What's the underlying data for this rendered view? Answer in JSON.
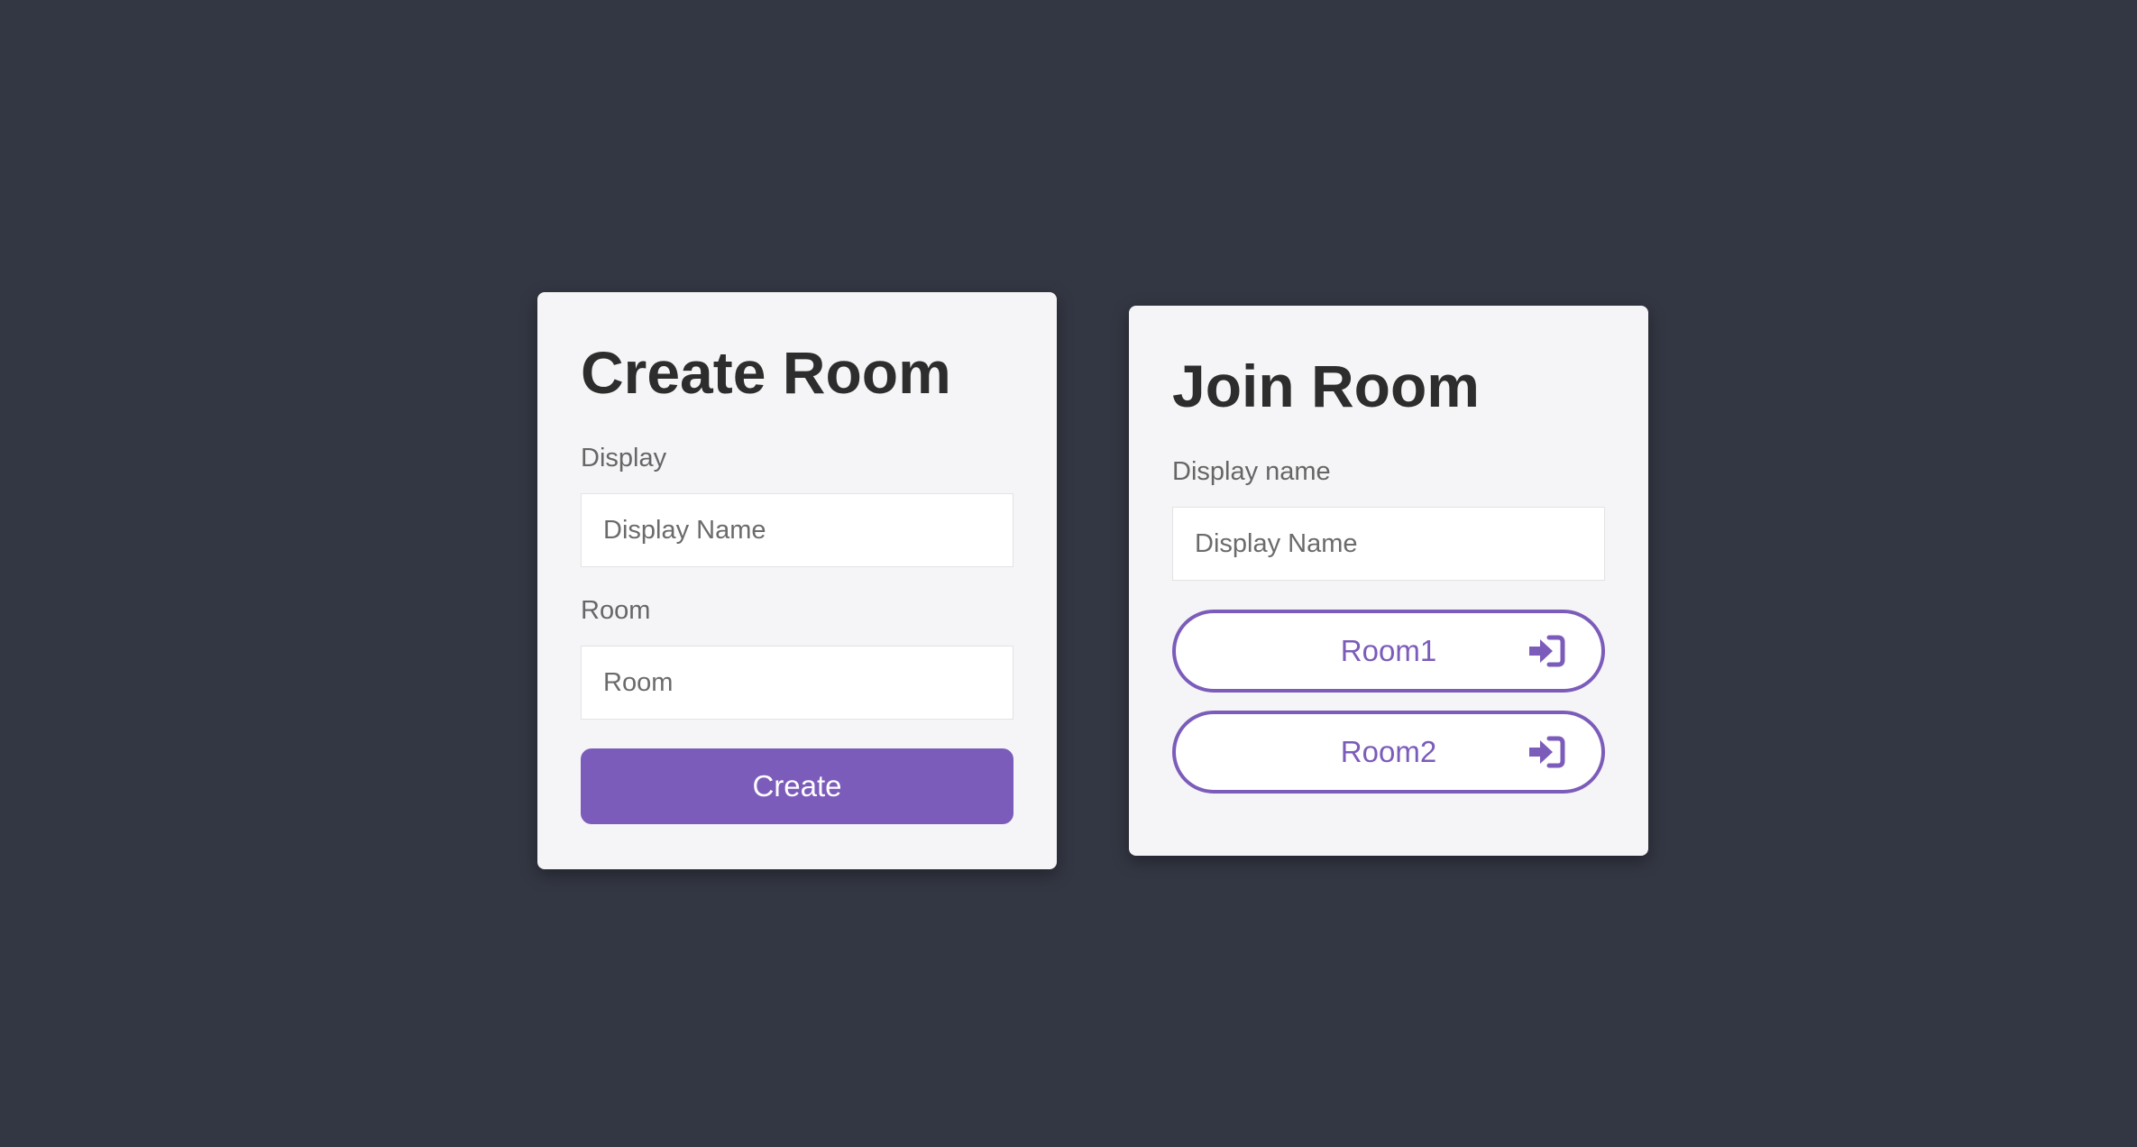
{
  "create_room": {
    "title": "Create Room",
    "display_label": "Display",
    "display_placeholder": "Display Name",
    "room_label": "Room",
    "room_placeholder": "Room",
    "create_button": "Create"
  },
  "join_room": {
    "title": "Join Room",
    "display_label": "Display name",
    "display_placeholder": "Display Name",
    "rooms": [
      {
        "label": "Room1",
        "icon": "sign-in-icon"
      },
      {
        "label": "Room2",
        "icon": "sign-in-icon"
      }
    ]
  },
  "colors": {
    "background": "#333743",
    "card": "#f5f5f7",
    "accent": "#7c5cba",
    "heading": "#2d2d2d"
  }
}
